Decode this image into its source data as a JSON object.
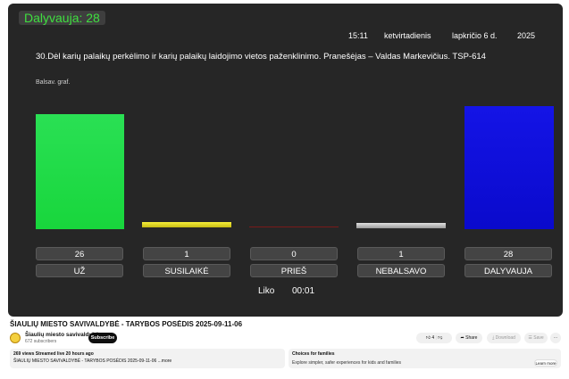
{
  "overlay": {
    "participating_badge": "Dalyvauja: 28"
  },
  "header": {
    "time": "15:11",
    "weekday": "ketvirtadienis",
    "date": "lapkričio 6 d.",
    "year": "2025"
  },
  "agenda_item": "30.Dėl karių palaikų perkėlimo ir karių palaikų laidojimo vietos paženklinimo. Pranešėjas – Valdas Markevičius. TSP-614",
  "chart_caption": "Balsav. graf.",
  "chart_data": {
    "type": "bar",
    "categories": [
      "UŽ",
      "SUSILAIKĖ",
      "PRIEŠ",
      "NEBALSAVO",
      "DALYVAUJA"
    ],
    "values": [
      26,
      1,
      0,
      1,
      28
    ],
    "colors": [
      "#1fdc45",
      "#e6dc22",
      "#7a1a1a",
      "#bdbdbd",
      "#0f0fd9"
    ],
    "ylim": [
      0,
      28
    ]
  },
  "counts": [
    "26",
    "1",
    "0",
    "1",
    "28"
  ],
  "labels": [
    "UŽ",
    "SUSILAIKĖ",
    "PRIEŠ",
    "NEBALSAVO",
    "DALYVAUJA"
  ],
  "timer": {
    "label": "Liko",
    "value": "00:01"
  },
  "video": {
    "title": "ŠIAULIŲ MIESTO SAVIVALDYBĖ - TARYBOS POSĖDIS 2025-09-11-06",
    "channel": "Šiaulių miesto savivaldybė",
    "subscribers": "672 subscribers",
    "subscribe": "Subscribe",
    "likes": "4",
    "share": "Share",
    "download": "Download",
    "save": "Save",
    "more": "⋯",
    "description_stats": "269 views  Streamed live 20 hours ago",
    "description_text": "ŠIAULIŲ MIESTO SAVIVALDYBĖ - TARYBOS POSĖDIS 2025-09-11-06 ...more"
  },
  "families": {
    "heading": "Choices for families",
    "text": "Explore simpler, safer experiences for kids and families",
    "button": "Learn more"
  },
  "icons": [
    "thumbs-up-icon",
    "thumbs-down-icon",
    "share-icon",
    "download-icon",
    "save-icon",
    "more-icon"
  ]
}
